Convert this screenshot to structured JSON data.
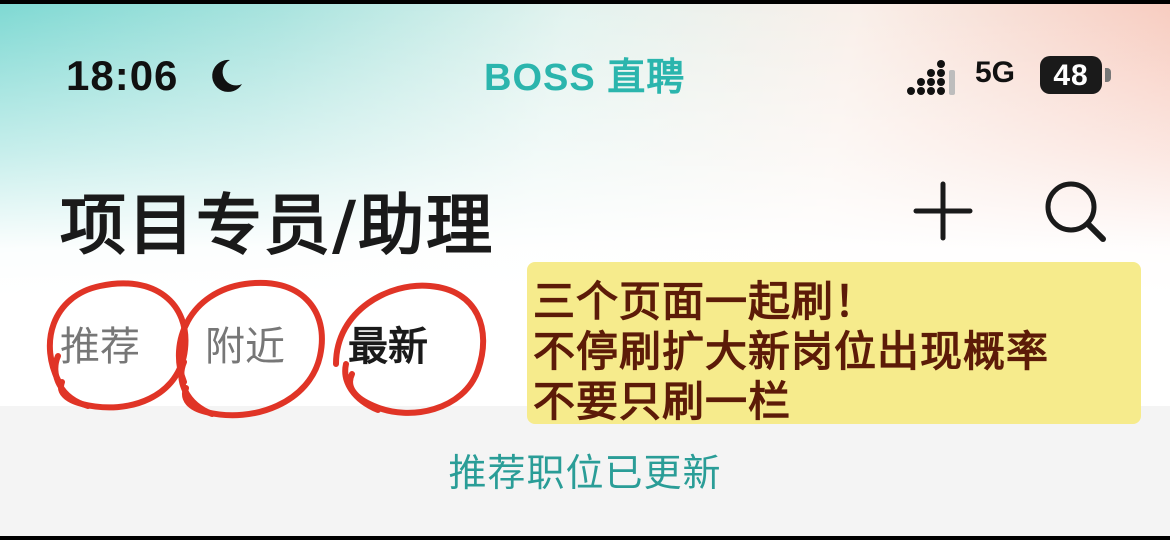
{
  "status_bar": {
    "time": "18:06",
    "network": "5G",
    "battery": "48",
    "moon_icon": "moon-icon",
    "signal_icon": "signal-icon"
  },
  "app": {
    "title": "BOSS 直聘",
    "brand_color": "#2bb5ad"
  },
  "header": {
    "title": "项目专员/助理",
    "add_icon": "plus-icon",
    "search_icon": "search-icon"
  },
  "tabs": [
    {
      "label": "推荐",
      "active": false
    },
    {
      "label": "附近",
      "active": false
    },
    {
      "label": "最新",
      "active": true
    }
  ],
  "annotation": {
    "lines": [
      "三个页面一起刷！",
      "不停刷扩大新岗位出现概率",
      "不要只刷一栏"
    ],
    "circle_color": "#e03426",
    "note_background": "#f6eb8c",
    "note_text_color": "#5c1b08"
  },
  "content": {
    "update_banner": "推荐职位已更新"
  }
}
